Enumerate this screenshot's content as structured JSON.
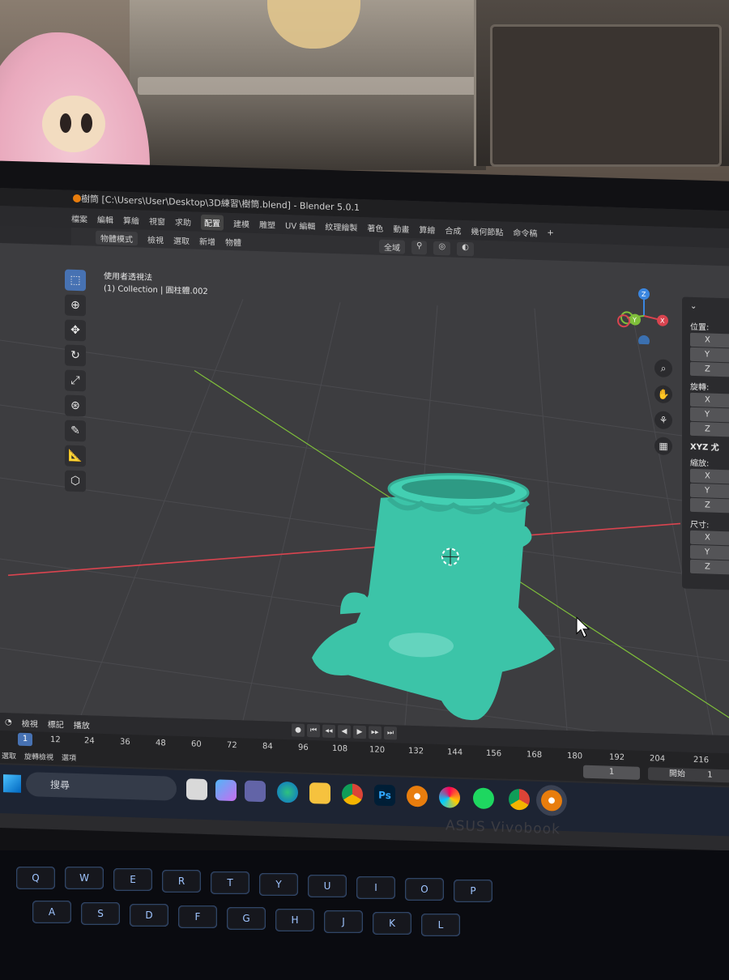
{
  "window": {
    "title": "樹筒 [C:\\Users\\User\\Desktop\\3D練習\\樹筒.blend] - Blender 5.0.1"
  },
  "menubar": {
    "items": [
      "檔案",
      "編輯",
      "算繪",
      "視窗",
      "求助"
    ],
    "workspace_tabs": [
      "配置",
      "建模",
      "雕塑",
      "UV 編輯",
      "紋理繪製",
      "著色",
      "動畫",
      "算繪",
      "合成",
      "幾何節點",
      "命令稿"
    ],
    "active_tab": "配置",
    "add_tab": "+"
  },
  "header": {
    "mode": "物體模式",
    "menus": [
      "檢視",
      "選取",
      "新增",
      "物體"
    ],
    "transform_orientation": "全域"
  },
  "viewport": {
    "view_name": "使用者透視法",
    "collection_info": "(1) Collection | 圓柱體.002",
    "gizmo_axes": [
      "X",
      "Y",
      "Z"
    ],
    "nav_icons": [
      "zoom-icon",
      "hand-icon",
      "camera-icon",
      "grid-icon"
    ]
  },
  "npanel": {
    "location_label": "位置:",
    "rotation_label": "旋轉:",
    "rotation_mode": "XYZ 尤",
    "scale_label": "縮放:",
    "dimensions_label": "尺寸:",
    "axes": [
      "X",
      "Y",
      "Z"
    ]
  },
  "timeline": {
    "menus": [
      "檢視",
      "標記",
      "播放"
    ],
    "current_frame": "1",
    "frame_ticks": [
      "12",
      "24",
      "36",
      "48",
      "60",
      "72",
      "84",
      "96",
      "108",
      "120",
      "132",
      "144",
      "156",
      "168",
      "180",
      "192",
      "204",
      "216"
    ],
    "status_items": [
      "選取",
      "旋轉檢視",
      "選項"
    ],
    "frame_field": "1",
    "start_label": "開始",
    "start_value": "1"
  },
  "taskbar": {
    "search_placeholder": "搜尋",
    "apps": [
      "file-explorer-icon",
      "copilot-icon",
      "teams-icon",
      "edge-icon",
      "folder-icon",
      "chrome-icon",
      "photoshop-icon",
      "blender-icon",
      "paint-icon",
      "spotify-icon",
      "chrome-icon",
      "blender-icon"
    ],
    "photoshop_label": "Ps"
  },
  "laptop": {
    "brand": "ASUS Vivobook"
  },
  "keyboard": {
    "keys": [
      "Q",
      "W",
      "E",
      "R",
      "T",
      "Y",
      "U",
      "I",
      "O",
      "P",
      "A",
      "S",
      "D",
      "F",
      "G",
      "H",
      "J",
      "K",
      "L"
    ]
  },
  "colors": {
    "model": "#3cc4a8",
    "x_axis": "#d9444f",
    "y_axis": "#7fbf3a",
    "z_axis": "#3a86e0",
    "active_tool": "#4772b3",
    "blender_orange": "#e87d0d"
  }
}
